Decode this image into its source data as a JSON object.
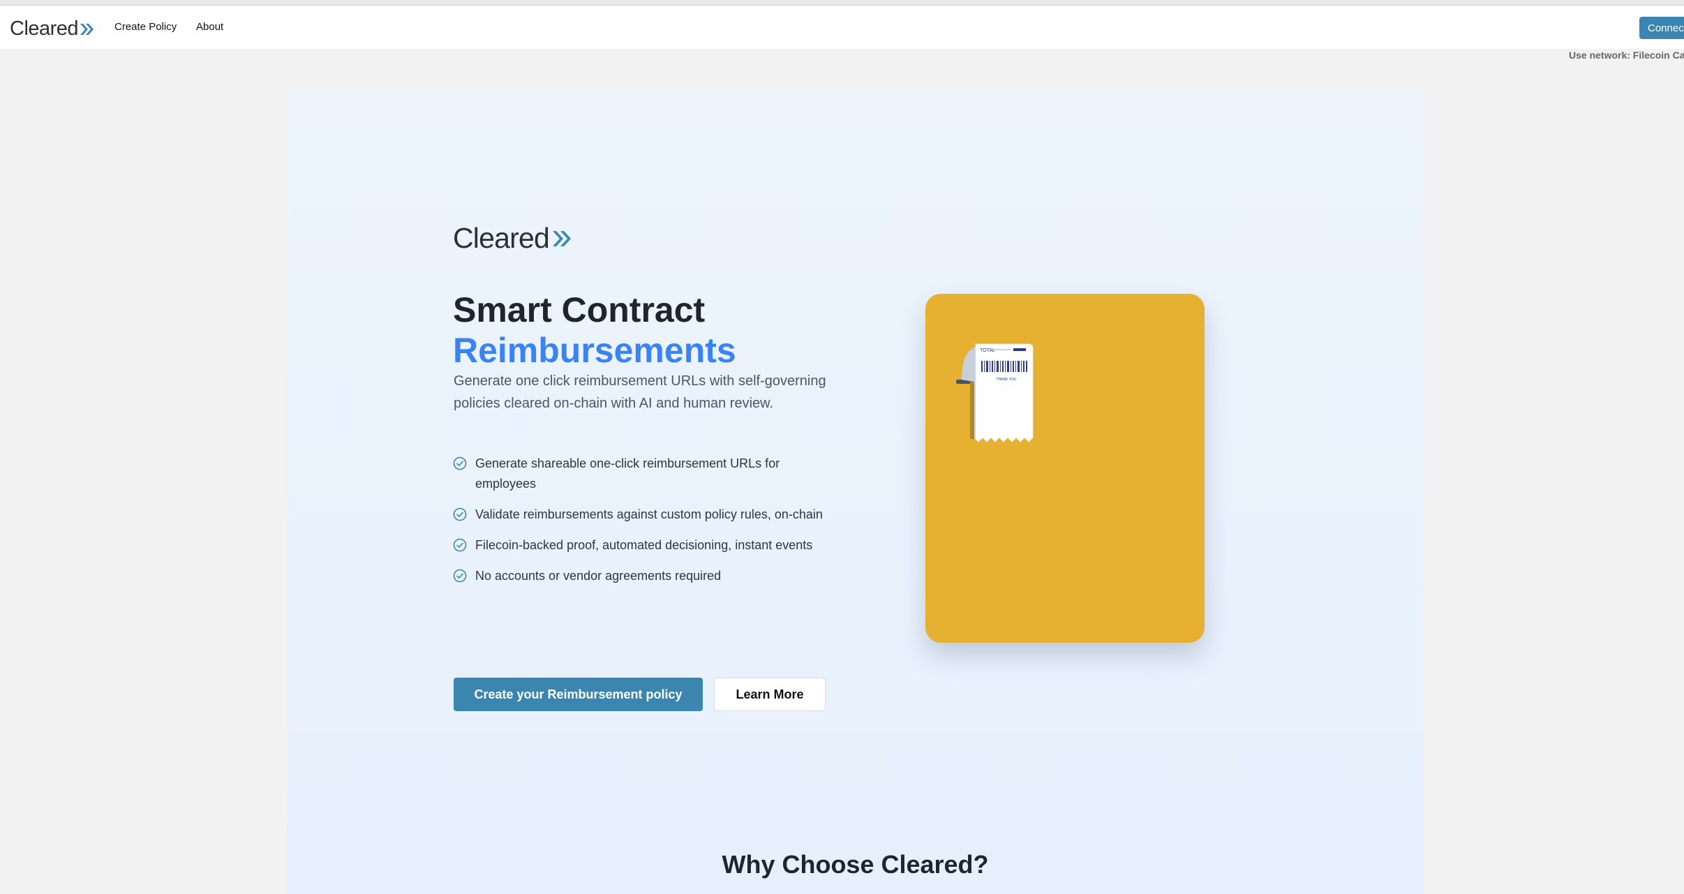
{
  "nav": {
    "logo_text": "Cleared",
    "links": [
      "Create Policy",
      "About"
    ],
    "connect_label": "Connec",
    "network_note": "Use network: Filecoin Ca"
  },
  "hero": {
    "brand_text": "Cleared",
    "title_line1": "Smart Contract",
    "title_line2": "Reimbursements",
    "subtitle": "Generate one click reimbursement URLs with self-governing policies cleared on-chain with AI and human review.",
    "features": [
      "Generate shareable one-click reimbursement URLs for employees",
      "Validate reimbursements against custom policy rules, on-chain",
      "Filecoin-backed proof, automated decisioning, instant events",
      "No accounts or vendor agreements required"
    ],
    "primary_cta": "Create your Reimbursement policy",
    "secondary_cta": "Learn More",
    "receipt": {
      "top_text": "TOTAL",
      "bottom_text": "THANK YOU"
    }
  },
  "section": {
    "why_title": "Why Choose Cleared?"
  },
  "colors": {
    "accent": "#3b82f6",
    "button": "#3a86b0",
    "card": "#e6b030",
    "hero_bg": "#edf4fd"
  }
}
